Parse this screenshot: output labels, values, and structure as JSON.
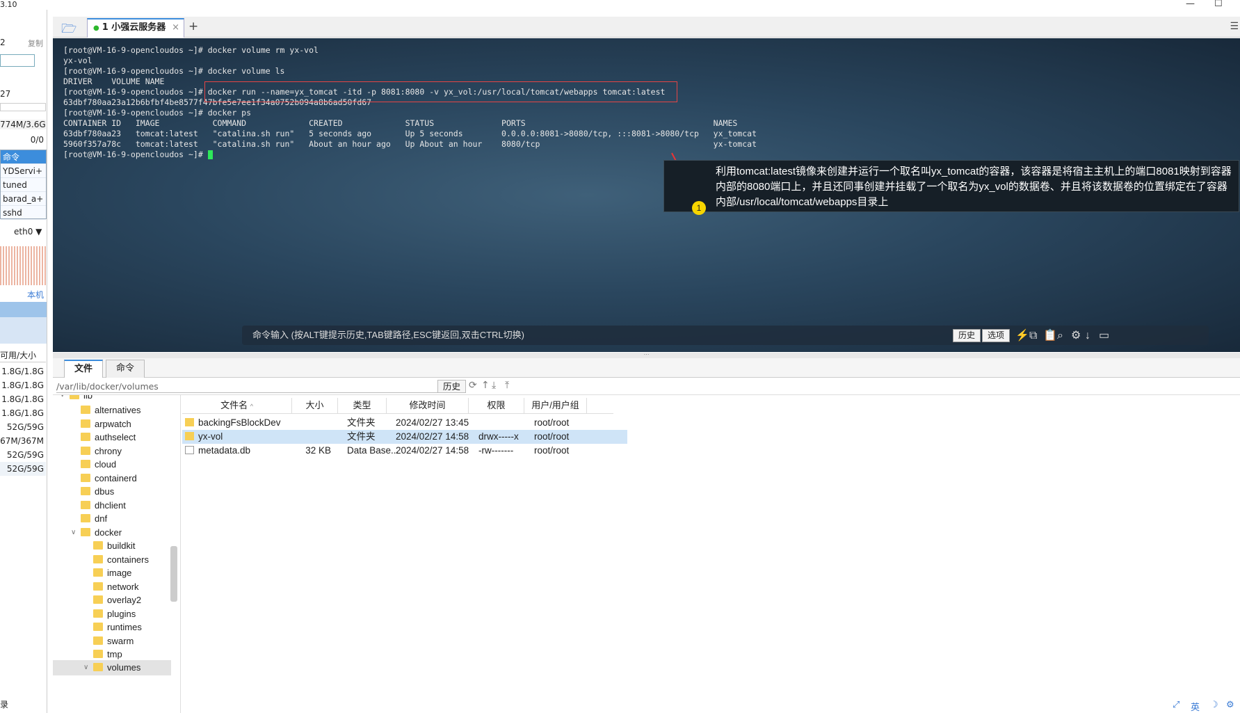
{
  "window": {
    "version_fragment": "3.10",
    "minimize": "—",
    "maximize": "☐"
  },
  "left_panel": {
    "rows": [
      "2",
      "复制",
      "27",
      "774M/3.6G",
      "0/0"
    ],
    "processes": {
      "header": "命令",
      "items": [
        "YDServi+",
        "tuned",
        "barad_a+",
        "sshd"
      ]
    },
    "net_iface": "eth0",
    "net_label": "本机",
    "disk_header": "可用/大小",
    "disks": [
      "1.8G/1.8G",
      "1.8G/1.8G",
      "1.8G/1.8G",
      "1.8G/1.8G",
      "52G/59G",
      "67M/367M",
      "52G/59G",
      "52G/59G"
    ],
    "bottom_fragment": "录"
  },
  "tabs": {
    "active_label": "1 小强云服务器",
    "close": "×",
    "add": "+"
  },
  "terminal": {
    "lines": [
      "[root@VM-16-9-opencloudos ~]# docker volume rm yx-vol",
      "yx-vol",
      "[root@VM-16-9-opencloudos ~]# docker volume ls",
      "DRIVER    VOLUME NAME",
      "[root@VM-16-9-opencloudos ~]# docker run --name=yx_tomcat -itd -p 8081:8080 -v yx_vol:/usr/local/tomcat/webapps tomcat:latest",
      "63dbf780aa23a12b6bfbf4be8577f47bfe5e7ee1f34a0752b094a8b6ad50fd67",
      "[root@VM-16-9-opencloudos ~]# docker ps",
      "CONTAINER ID   IMAGE           COMMAND             CREATED             STATUS              PORTS                                       NAMES",
      "63dbf780aa23   tomcat:latest   \"catalina.sh run\"   5 seconds ago       Up 5 seconds        0.0.0.0:8081->8080/tcp, :::8081->8080/tcp   yx_tomcat",
      "5960f357a78c   tomcat:latest   \"catalina.sh run\"   About an hour ago   Up About an hour    8080/tcp                                    yx-tomcat",
      "[root@VM-16-9-opencloudos ~]# "
    ],
    "annotation": {
      "badge": "1",
      "text": "利用tomcat:latest镜像来创建并运行一个取名叫yx_tomcat的容器，该容器是将宿主主机上的端口8081映射到容器内部的8080端口上，并且还同事创建并挂载了一个取名为yx_vol的数据卷、并且将该数据卷的位置绑定在了容器内部/usr/local/tomcat/webapps目录上"
    },
    "command_input": {
      "placeholder": "命令输入 (按ALT键提示历史,TAB键路径,ESC键返回,双击CTRL切换)",
      "history_btn": "历史",
      "options_btn": "选项"
    }
  },
  "file_manager": {
    "tabs": [
      "文件",
      "命令"
    ],
    "path": "/var/lib/docker/volumes",
    "history_btn": "历史",
    "tree": [
      {
        "label": "lib",
        "depth": 0,
        "expanded": true
      },
      {
        "label": "alternatives",
        "depth": 1
      },
      {
        "label": "arpwatch",
        "depth": 1
      },
      {
        "label": "authselect",
        "depth": 1
      },
      {
        "label": "chrony",
        "depth": 1
      },
      {
        "label": "cloud",
        "depth": 1
      },
      {
        "label": "containerd",
        "depth": 1
      },
      {
        "label": "dbus",
        "depth": 1
      },
      {
        "label": "dhclient",
        "depth": 1
      },
      {
        "label": "dnf",
        "depth": 1
      },
      {
        "label": "docker",
        "depth": 1,
        "expanded": true
      },
      {
        "label": "buildkit",
        "depth": 2
      },
      {
        "label": "containers",
        "depth": 2
      },
      {
        "label": "image",
        "depth": 2
      },
      {
        "label": "network",
        "depth": 2
      },
      {
        "label": "overlay2",
        "depth": 2
      },
      {
        "label": "plugins",
        "depth": 2
      },
      {
        "label": "runtimes",
        "depth": 2
      },
      {
        "label": "swarm",
        "depth": 2
      },
      {
        "label": "tmp",
        "depth": 2
      },
      {
        "label": "volumes",
        "depth": 2,
        "expanded": true,
        "selected": true
      }
    ],
    "columns": [
      "文件名",
      "大小",
      "类型",
      "修改时间",
      "权限",
      "用户/用户组"
    ],
    "files": [
      {
        "name": "backingFsBlockDev",
        "size": "",
        "type": "文件夹",
        "mtime": "2024/02/27 13:45",
        "perm": "",
        "owner": "root/root",
        "kind": "folder"
      },
      {
        "name": "yx-vol",
        "size": "",
        "type": "文件夹",
        "mtime": "2024/02/27 14:58",
        "perm": "drwx-----x",
        "owner": "root/root",
        "kind": "folder",
        "selected": true
      },
      {
        "name": "metadata.db",
        "size": "32 KB",
        "type": "Data Base...",
        "mtime": "2024/02/27 14:58",
        "perm": "-rw-------",
        "owner": "root/root",
        "kind": "file"
      }
    ]
  },
  "tray": {
    "lang": "英"
  }
}
